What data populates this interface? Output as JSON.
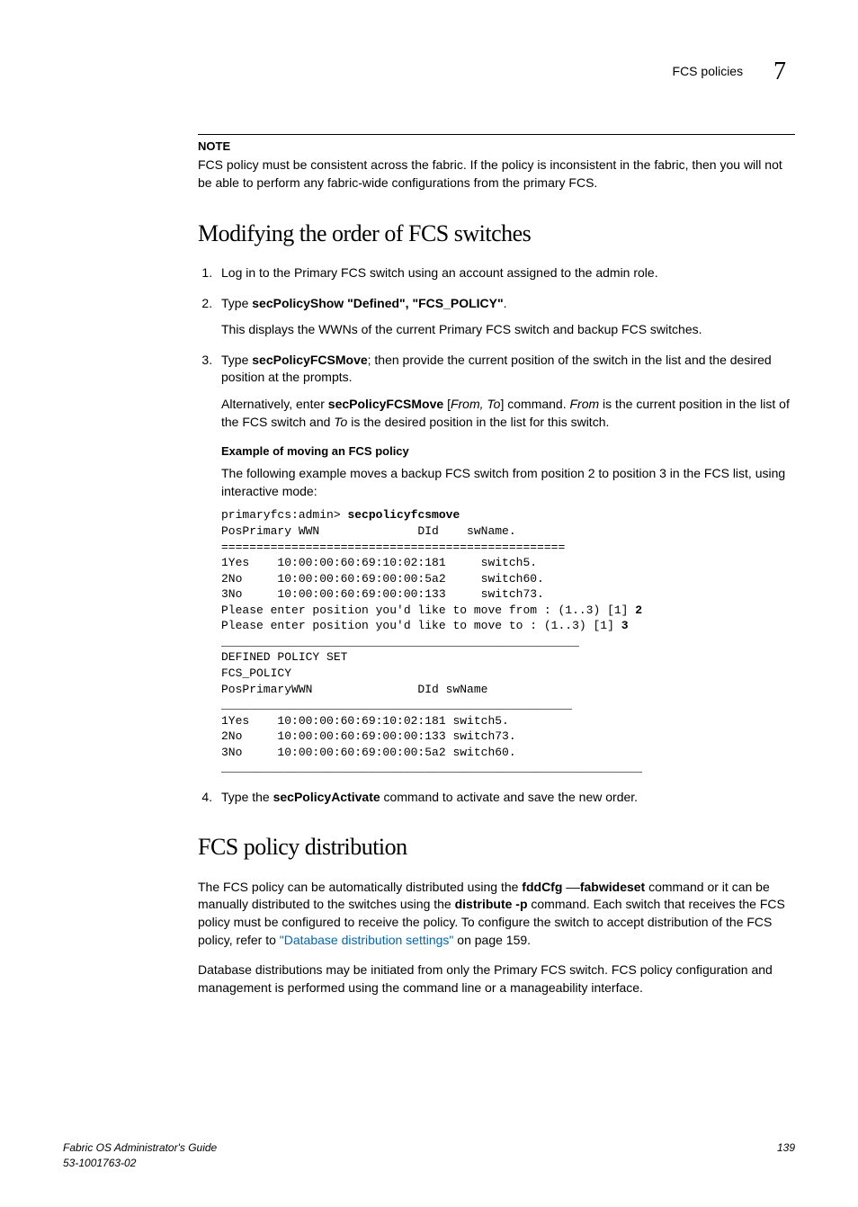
{
  "header": {
    "section": "FCS policies",
    "chapter": "7"
  },
  "note": {
    "label": "NOTE",
    "text": "FCS policy must be consistent across the fabric. If the policy is inconsistent in the fabric, then you will not be able to perform any fabric-wide configurations from the primary FCS."
  },
  "h1": "Modifying the order of FCS switches",
  "steps": {
    "s1": "Log in to the Primary FCS switch using an account assigned to the admin role.",
    "s2_pre": "Type ",
    "s2_cmd": "secPolicyShow \"Defined\", \"FCS_POLICY\"",
    "s2_post": ".",
    "s2_follow": "This displays the WWNs of the current Primary FCS switch and backup FCS switches.",
    "s3_pre": "Type ",
    "s3_cmd": "secPolicyFCSMove",
    "s3_post": "; then provide the current position of the switch in the list and the desired position at the prompts.",
    "s3_alt_a": "Alternatively, enter ",
    "s3_alt_b": "secPolicyFCSMove",
    "s3_alt_c": " [",
    "s3_alt_d": "From, To",
    "s3_alt_e": "] command. ",
    "s3_alt_f": "From",
    "s3_alt_g": " is the current position in the list of the FCS switch and ",
    "s3_alt_h": "To",
    "s3_alt_i": " is the desired position in the list for this switch.",
    "example_h": "Example  of moving an FCS policy",
    "example_p": "The following example moves a backup FCS switch from position 2 to position 3 in the FCS list, using interactive mode:",
    "s4_pre": "Type the ",
    "s4_cmd": "secPolicyActivate",
    "s4_post": " command to activate and save the new order."
  },
  "code": {
    "l01a": "primaryfcs:admin> ",
    "l01b": "secpolicyfcsmove",
    "l02": "PosPrimary WWN              DId    swName.",
    "l03": "=================================================",
    "l04": "1Yes    10:00:00:60:69:10:02:181     switch5.",
    "l05": "2No     10:00:00:60:69:00:00:5a2     switch60.",
    "l06": "3No     10:00:00:60:69:00:00:133     switch73.",
    "l07a": "Please enter position you'd like to move from : (1..3) [1] ",
    "l07b": "2",
    "l08a": "Please enter position you'd like to move to : (1..3) [1] ",
    "l08b": "3",
    "l09": "___________________________________________________",
    "l10": "DEFINED POLICY SET",
    "l11": "FCS_POLICY",
    "l12": "PosPrimaryWWN               DId swName",
    "l13": "__________________________________________________",
    "l14": "1Yes    10:00:00:60:69:10:02:181 switch5.",
    "l15": "2No     10:00:00:60:69:00:00:133 switch73.",
    "l16": "3No     10:00:00:60:69:00:00:5a2 switch60.",
    "l17": "____________________________________________________________"
  },
  "h2": "FCS policy distribution",
  "dist": {
    "p1a": "The FCS policy can be automatically distributed using the ",
    "p1b": "fddCfg",
    "p1c": " ––",
    "p1d": "fabwideset",
    "p1e": " command or it can be manually distributed to the switches using the ",
    "p1f": "distribute -p",
    "p1g": " command. Each switch that receives the FCS policy must be configured to receive the policy. To configure the switch to accept distribution of the FCS policy, refer to ",
    "p1link": "\"Database distribution settings\"",
    "p1h": " on page 159.",
    "p2": "Database distributions may be initiated from only the Primary FCS switch. FCS policy configuration and management is performed using the command line or a manageability interface."
  },
  "footer": {
    "title": "Fabric OS Administrator's Guide",
    "docnum": "53-1001763-02",
    "page": "139"
  }
}
